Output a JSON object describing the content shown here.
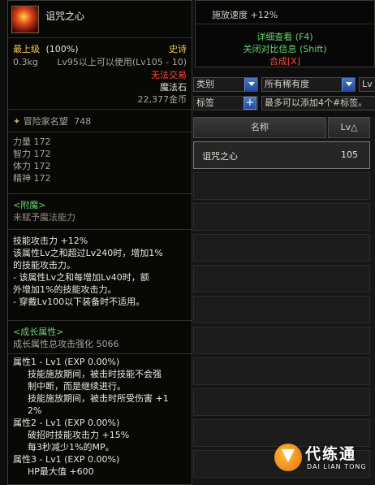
{
  "tooltip": {
    "item_name": "诅咒之心",
    "grade": "最上级",
    "grade_pct": "(100%)",
    "rarity": "史诗",
    "weight": "0.3kg",
    "level_req": "Lv95以上可以使用(Lv105 - 10)",
    "trade": "无法交易",
    "type": "魔法石",
    "price": "22,377金币",
    "adventurer_label": "冒险家名望",
    "adventurer_value": "748",
    "stats": [
      {
        "label": "力量",
        "value": "172"
      },
      {
        "label": "智力",
        "value": "172"
      },
      {
        "label": "体力",
        "value": "172"
      },
      {
        "label": "精神",
        "value": "172"
      }
    ],
    "enchant_title": "<附魔>",
    "enchant_value": "未赋予魔法能力",
    "effect_lines": [
      "技能攻击力 +12%",
      "该属性Lv之和超过Lv240时，增加1%",
      "的技能攻击力。",
      "- 该属性Lv之和每增加Lv40时，额",
      "外增加1%的技能攻击力。",
      "- 穿戴Lv100以下装备时不适用。"
    ],
    "growth_title": "<成长属性>",
    "growth_total_label": "成长属性总攻击强化",
    "growth_total_value": "5066",
    "growth": [
      {
        "title": "属性1 - Lv1 (EXP 0.00%)",
        "lines": [
          "技能施放期间，被击时技能不会强",
          "制中断，而是继续进行。",
          "技能施放期间，被击时所受伤害 +1",
          "2%"
        ]
      },
      {
        "title": "属性2 - Lv1 (EXP 0.00%)",
        "lines": [
          "破招时技能攻击力 +15%",
          "每3秒减少1%的MP。"
        ]
      },
      {
        "title": "属性3 - Lv1 (EXP 0.00%)",
        "lines": [
          "HP最大值 +600"
        ]
      }
    ]
  },
  "compare_tip": {
    "speed": "施放速度 +12%",
    "detail": "详细查看 (F4)",
    "close_compare": "关闭对比信息 (Shift)",
    "compose": "合成[X]"
  },
  "filters": {
    "type_partial": "类别",
    "rarity": "所有稀有度",
    "level_partial": "Lv",
    "tag_label": "标签",
    "tag_placeholder": "最多可以添加4个#标签。"
  },
  "table": {
    "col_name": "名称",
    "col_lv": "Lv△",
    "rows": [
      {
        "name": "诅咒之心",
        "lv": "105"
      }
    ]
  },
  "watermark": {
    "title": "代练通",
    "subtitle": "DAI LIAN TONG"
  },
  "colors": {
    "epic": "#f6c94a",
    "untradable": "#ff4a3a",
    "enchant": "#67d36b",
    "compose": "#ff4a3a"
  }
}
